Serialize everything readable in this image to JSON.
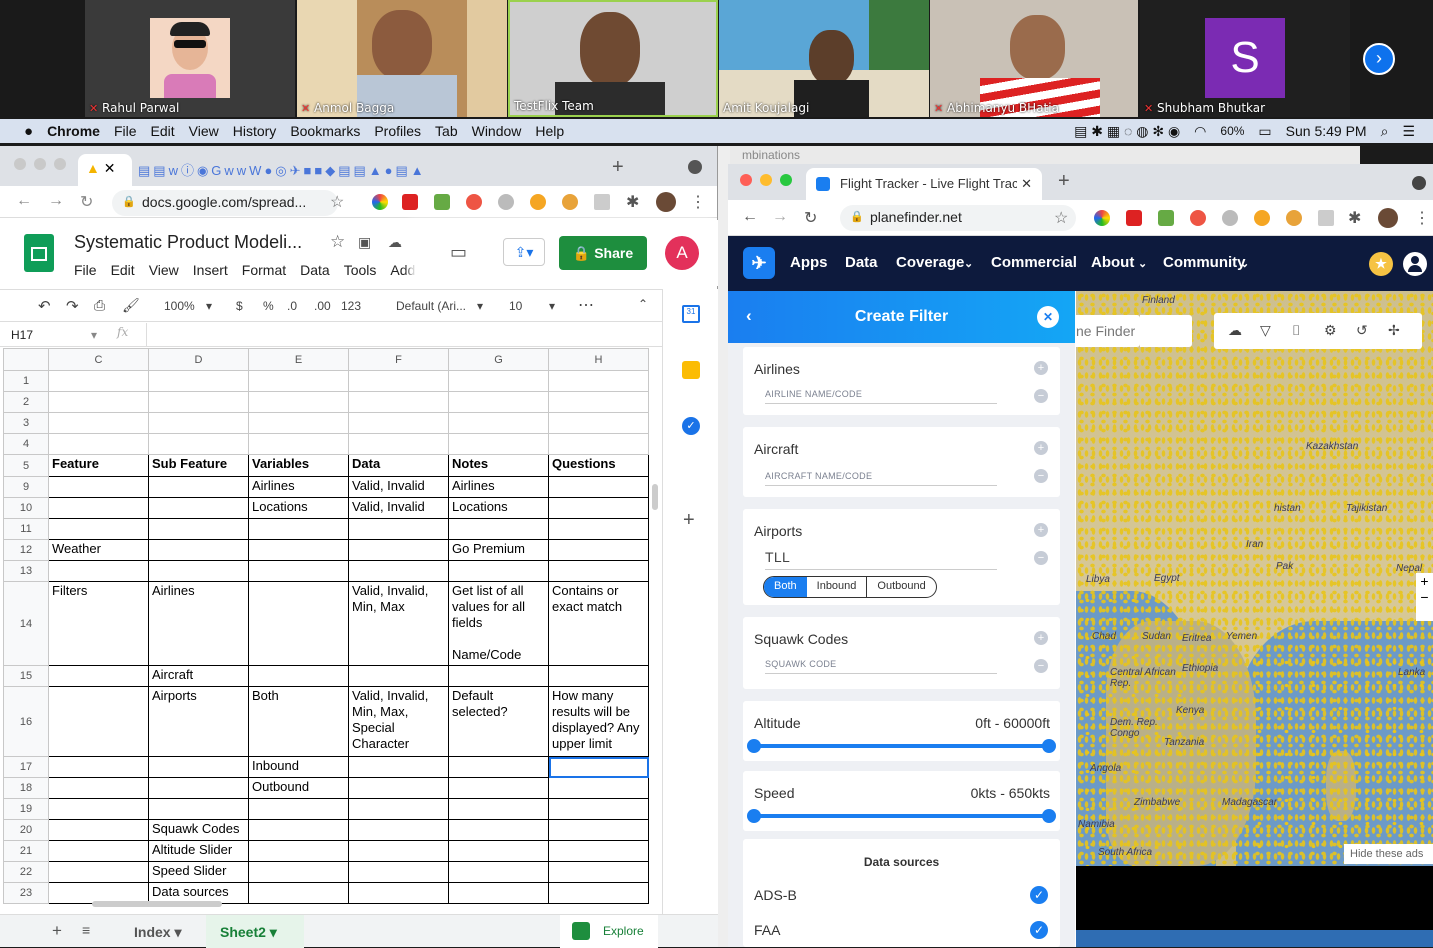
{
  "zoom": {
    "participants": [
      {
        "name": "Rahul Parwal",
        "muted": true
      },
      {
        "name": "Anmol Bagga",
        "muted": true
      },
      {
        "name": "TestFlix Team",
        "muted": false
      },
      {
        "name": "Amit Koujalagi",
        "muted": false
      },
      {
        "name": "Abhimanyu BHatia",
        "muted": true
      },
      {
        "name": "Shubham Bhutkar",
        "muted": true,
        "initial": "S"
      }
    ]
  },
  "menubar": {
    "apple": "",
    "app": "Chrome",
    "items": [
      "File",
      "Edit",
      "View",
      "History",
      "Bookmarks",
      "Profiles",
      "Tab",
      "Window",
      "Help"
    ],
    "battery": "60%",
    "clock": "Sun 5:49 PM"
  },
  "sheets": {
    "url": "docs.google.com/spread...",
    "doc_title": "Systematic Product Modeli...",
    "menu": [
      "File",
      "Edit",
      "View",
      "Insert",
      "Format",
      "Data",
      "Tools",
      "Add"
    ],
    "share_label": "Share",
    "avatar": "A",
    "toolbar": {
      "zoom": "100%",
      "currency": "$",
      "percent": "%",
      "dec_less": ".0",
      "dec_more": ".00",
      "format123": "123",
      "font": "Default (Ari...",
      "size": "10"
    },
    "cell_ref": "H17",
    "fx": "fx",
    "columns": [
      "C",
      "D",
      "E",
      "F",
      "G",
      "H"
    ],
    "rows": [
      {
        "n": "1",
        "c": [
          "",
          "",
          "",
          "",
          "",
          ""
        ]
      },
      {
        "n": "2",
        "c": [
          "",
          "",
          "",
          "",
          "",
          ""
        ]
      },
      {
        "n": "3",
        "c": [
          "",
          "",
          "",
          "",
          "",
          ""
        ]
      },
      {
        "n": "4",
        "c": [
          "",
          "",
          "",
          "",
          "",
          ""
        ]
      },
      {
        "n": "5",
        "c": [
          "Feature",
          "Sub Feature",
          "Variables",
          "Data",
          "Notes",
          "Questions"
        ]
      },
      {
        "n": "9",
        "c": [
          "",
          "",
          "Airlines",
          "Valid, Invalid",
          "Airlines",
          ""
        ]
      },
      {
        "n": "10",
        "c": [
          "",
          "",
          "Locations",
          "Valid, Invalid",
          "Locations",
          ""
        ]
      },
      {
        "n": "11",
        "c": [
          "",
          "",
          "",
          "",
          "",
          ""
        ]
      },
      {
        "n": "12",
        "c": [
          "Weather",
          "",
          "",
          "",
          "Go Premium",
          ""
        ]
      },
      {
        "n": "13",
        "c": [
          "",
          "",
          "",
          "",
          "",
          ""
        ]
      },
      {
        "n": "14",
        "c": [
          "Filters",
          "Airlines",
          "",
          "Valid, Invalid, Min, Max",
          "Get list of all values for all fields\n\nName/Code",
          "Contains or exact match"
        ]
      },
      {
        "n": "15",
        "c": [
          "",
          "Aircraft",
          "",
          "",
          "",
          ""
        ]
      },
      {
        "n": "16",
        "c": [
          "",
          "Airports",
          "Both",
          "Valid, Invalid, Min, Max, Special Character",
          "Default selected?",
          "How many results will be displayed? Any upper limit"
        ]
      },
      {
        "n": "17",
        "c": [
          "",
          "",
          "Inbound",
          "",
          "",
          ""
        ]
      },
      {
        "n": "18",
        "c": [
          "",
          "",
          "Outbound",
          "",
          "",
          ""
        ]
      },
      {
        "n": "19",
        "c": [
          "",
          "",
          "",
          "",
          "",
          ""
        ]
      },
      {
        "n": "20",
        "c": [
          "",
          "Squawk Codes",
          "",
          "",
          "",
          ""
        ]
      },
      {
        "n": "21",
        "c": [
          "",
          "Altitude Slider",
          "",
          "",
          "",
          ""
        ]
      },
      {
        "n": "22",
        "c": [
          "",
          "Speed Slider",
          "",
          "",
          "",
          ""
        ]
      },
      {
        "n": "23",
        "c": [
          "",
          "Data sources",
          "",
          "",
          "",
          ""
        ]
      }
    ],
    "sheet_tabs": [
      "Index",
      "Sheet2"
    ],
    "explore": "Explore"
  },
  "planefinder": {
    "tab_title": "Flight Tracker - Live Flight Trac",
    "behind_tab": "mbinations",
    "url": "planefinder.net",
    "nav": [
      "Apps",
      "Data",
      "Coverage",
      "Commercial",
      "About",
      "Community"
    ],
    "filter_title": "Create Filter",
    "airlines_label": "Airlines",
    "airlines_placeholder": "AIRLINE NAME/CODE",
    "aircraft_label": "Aircraft",
    "aircraft_placeholder": "AIRCRAFT NAME/CODE",
    "airports_label": "Airports",
    "airports_value": "TLL",
    "airport_modes": [
      "Both",
      "Inbound",
      "Outbound"
    ],
    "squawk_label": "Squawk Codes",
    "squawk_placeholder": "SQUAWK CODE",
    "altitude_label": "Altitude",
    "altitude_range": "0ft - 60000ft",
    "speed_label": "Speed",
    "speed_range": "0kts - 650kts",
    "data_sources_title": "Data sources",
    "sources": [
      "ADS-B",
      "FAA"
    ],
    "map_search": "ne Finder",
    "map_labels": [
      "Finland",
      "Kazakhstan",
      "Tajikistan",
      "Libya",
      "Chad",
      "Sudan",
      "Eritrea",
      "Yemen",
      "Ethiopia",
      "Central African Rep.",
      "Dem. Rep. Congo",
      "Kenya",
      "Tanzania",
      "Angola",
      "Zimbabwe",
      "Madagascar",
      "Namibia",
      "South Africa",
      "Nepal",
      "Lanka",
      "Egypt",
      "Pak",
      "Iran",
      "histan"
    ],
    "hide_ads": "Hide these ads"
  }
}
